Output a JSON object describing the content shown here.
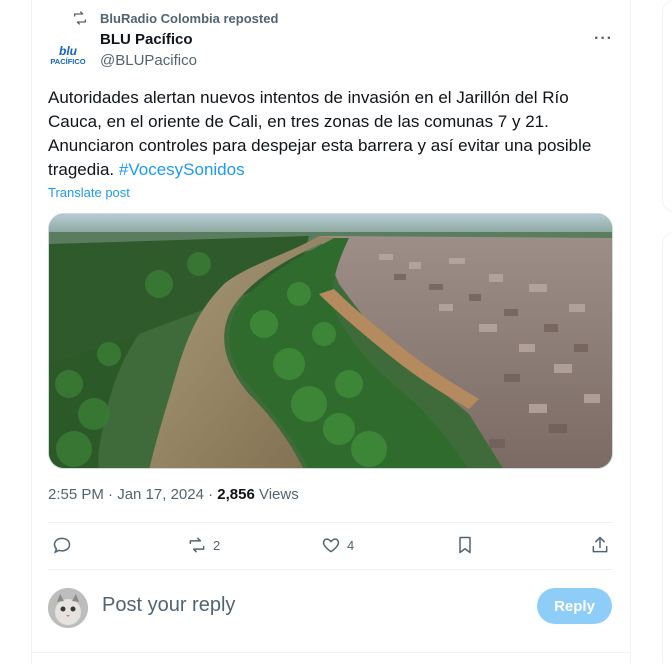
{
  "repost": {
    "text": "BluRadio Colombia reposted"
  },
  "author": {
    "logo_line1": "blu",
    "logo_line2": "PACÍFICO",
    "name": "BLU Pacífico",
    "handle": "@BLUPacifico"
  },
  "tweet": {
    "text": "Autoridades alertan nuevos intentos de invasión en el Jarillón del Río Cauca, en el oriente de Cali, en tres zonas de las comunas 7 y 21. Anunciaron controles para despejar esta barrera y así evitar una posible tragedia. ",
    "hashtag": "#VocesySonidos",
    "translate_label": "Translate post",
    "timestamp": "2:55 PM · Jan 17, 2024 · ",
    "views_count": "2,856",
    "views_label": " Views"
  },
  "actions": {
    "reply_icon": "reply-icon",
    "repost_count": "2",
    "like_count": "4",
    "bookmark_icon": "bookmark-icon",
    "share_icon": "share-icon"
  },
  "reply": {
    "placeholder": "Post your reply",
    "button_label": "Reply"
  },
  "colors": {
    "accent": "#1d9bf0",
    "reply_button": "#8ecdf8",
    "muted_text": "#536471"
  }
}
